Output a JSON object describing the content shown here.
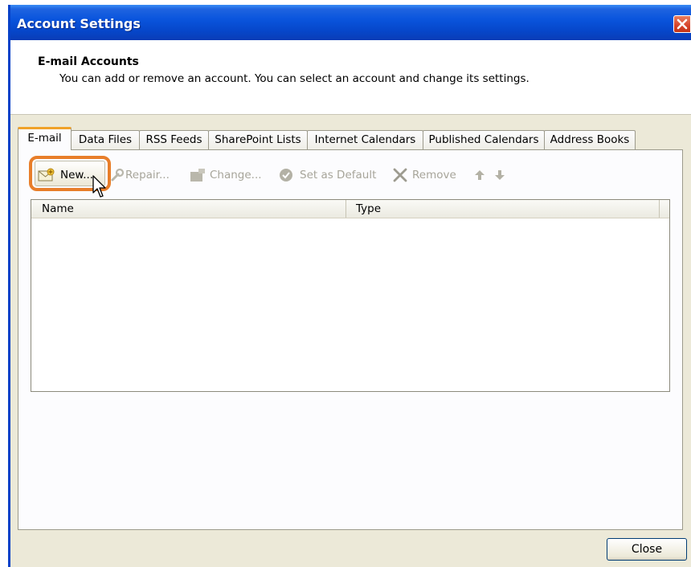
{
  "window": {
    "title": "Account Settings"
  },
  "header": {
    "title": "E-mail Accounts",
    "description": "You can add or remove an account. You can select an account and change its settings."
  },
  "tabs": [
    {
      "label": "E-mail",
      "active": true
    },
    {
      "label": "Data Files",
      "active": false
    },
    {
      "label": "RSS Feeds",
      "active": false
    },
    {
      "label": "SharePoint Lists",
      "active": false
    },
    {
      "label": "Internet Calendars",
      "active": false
    },
    {
      "label": "Published Calendars",
      "active": false
    },
    {
      "label": "Address Books",
      "active": false
    }
  ],
  "toolbar": {
    "new_label": "New...",
    "repair_label": "Repair...",
    "change_label": "Change...",
    "set_default_label": "Set as Default",
    "remove_label": "Remove",
    "icons": {
      "new": "new-mail-account-icon",
      "repair": "repair-icon",
      "change": "change-icon",
      "set_default": "checkmark-icon",
      "remove": "remove-x-icon",
      "up": "arrow-up-icon",
      "down": "arrow-down-icon"
    },
    "disabled_color": "#a7a59a"
  },
  "list": {
    "columns": [
      "Name",
      "Type"
    ],
    "rows": []
  },
  "footer": {
    "close_label": "Close"
  },
  "colors": {
    "titlebar": "#0a55dd",
    "highlight": "#e87e2a",
    "active_tab_accent": "#f0a22a",
    "dialog_bg": "#ece9d8"
  }
}
